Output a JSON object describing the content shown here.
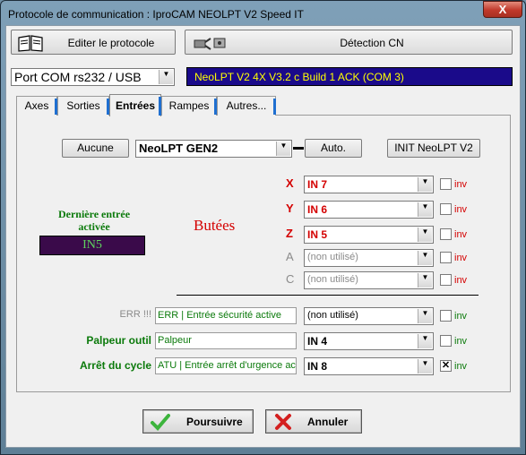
{
  "window": {
    "title": "Protocole de communication : IproCAM NEOLPT V2 Speed IT",
    "close_label": "X"
  },
  "toolbar": {
    "edit_label": "Editer le protocole",
    "detect_label": "Détection CN"
  },
  "port": {
    "selected": "Port COM rs232 / USB",
    "status": "NeoLPT V2 4X V3.2 c Build 1 ACK  (COM 3)"
  },
  "tabs": [
    "Axes",
    "Sorties",
    "Entrées",
    "Rampes",
    "Autres..."
  ],
  "active_tab": "Entrées",
  "controls": {
    "none_label": "Aucune",
    "device": "NeoLPT GEN2",
    "auto_label": "Auto.",
    "init_label": "INIT NeoLPT V2"
  },
  "last_input": {
    "title": "Dernière entrée activée",
    "value": "IN5"
  },
  "butees": {
    "title": "Butées"
  },
  "axes": [
    {
      "label": "X",
      "value": "IN 7",
      "inv": "inv"
    },
    {
      "label": "Y",
      "value": "IN 6",
      "inv": "inv"
    },
    {
      "label": "Z",
      "value": "IN 5",
      "inv": "inv"
    },
    {
      "label": "A",
      "value": "(non utilisé)",
      "inv": "inv"
    },
    {
      "label": "C",
      "value": "(non utilisé)",
      "inv": "inv"
    }
  ],
  "inputs": [
    {
      "label": "ERR !!!",
      "desc": "ERR | Entrée sécurité active",
      "value": "(non utilisé)",
      "inv": "inv",
      "checked": false
    },
    {
      "label": "Palpeur outil",
      "desc": "Palpeur",
      "value": "IN 4",
      "inv": "inv",
      "checked": false
    },
    {
      "label": "Arrêt du cycle",
      "desc": "ATU | Entrée arrêt d'urgence act",
      "value": "IN 8",
      "inv": "inv",
      "checked": true
    }
  ],
  "footer": {
    "continue_label": "Poursuivre",
    "cancel_label": "Annuler"
  },
  "colors": {
    "red": "#d40000",
    "green": "#0b7a0b",
    "status_bg": "#1a0a8a",
    "status_text": "#ffff00",
    "last_input_bg": "#3a0a4a"
  }
}
